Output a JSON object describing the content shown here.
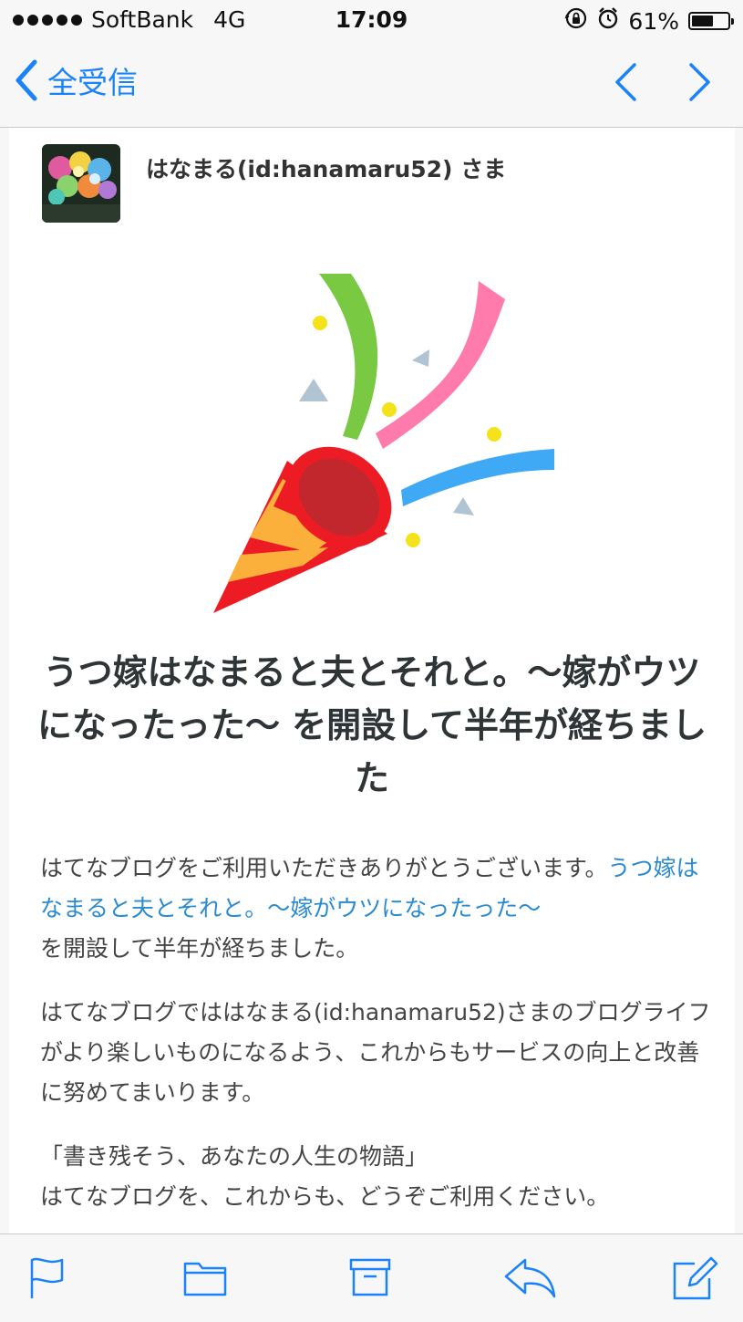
{
  "status_bar": {
    "carrier": "SoftBank",
    "network": "4G",
    "time": "17:09",
    "battery_percent": "61%",
    "battery_level": 0.61,
    "icons": [
      "signal-dots-icon",
      "orientation-lock-icon",
      "alarm-icon",
      "battery-icon"
    ]
  },
  "nav": {
    "back_label": "全受信",
    "icons": [
      "chevron-left-icon",
      "up-arrow-icon",
      "down-arrow-icon"
    ]
  },
  "mail": {
    "sender": "はなまる(id:hanamaru52) さま",
    "headline": "うつ嫁はなまると夫とそれと。〜嫁がウツになったった〜 を開設して半年が経ちました",
    "p1_text": "はてなブログをご利用いただきありがとうございます。",
    "p1_link": "うつ嫁はなまると夫とそれと。〜嫁がウツになったった〜",
    "p1_suffix": "を開設して半年が経ちました。",
    "p2": "はてなブログでははなまる(id:hanamaru52)さまのブログライフがより楽しいものになるよう、これからもサービスの向上と改善に努めてまいります。",
    "p3_line1": "「書き残そう、あなたの人生の物語」",
    "p3_line2": "はてなブログを、これからも、どうぞご利用ください。"
  },
  "toolbar": {
    "icons": [
      "flag-icon",
      "folder-icon",
      "archive-icon",
      "reply-icon",
      "compose-icon"
    ]
  },
  "colors": {
    "accent": "#1a82fb",
    "link": "#2a8ad2",
    "headline": "#2f3436"
  }
}
